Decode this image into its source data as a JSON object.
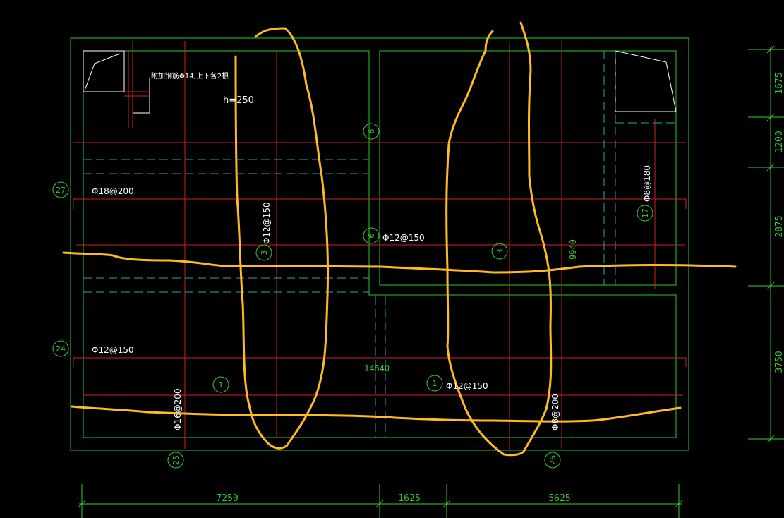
{
  "colors": {
    "background": "#000000",
    "outline": "#22cc22",
    "rebar": "#cc2222",
    "hidden": "#1fa8a8",
    "markup": "#ffbb22",
    "text": "#ffffff",
    "dimension": "#33cc33"
  },
  "annotations": {
    "note": "附加钢筋Φ14,上下各2根",
    "thickness": "h=250",
    "rebar_18_200": "Φ18@200",
    "rebar_12_150_top": "Φ12@150",
    "rebar_12_150_mid": "Φ12@150",
    "rebar_12_150_left": "Φ12@150",
    "rebar_12_150_bottom": "Φ12@150",
    "rebar_16_200": "Φ16@200",
    "rebar_8_200": "Φ8@200",
    "rebar_8_180": "Φ8@180",
    "length_9940": "9940",
    "length_14840": "14840"
  },
  "bubbles": {
    "b27": "27",
    "b24": "24",
    "b25": "25",
    "b26": "26",
    "b6a": "6",
    "b6b": "6",
    "b3a": "3",
    "b3b": "3",
    "b17": "17",
    "b1a": "1",
    "b1b": "1"
  },
  "dimensions": {
    "bottom": [
      "7250",
      "1625",
      "5625"
    ],
    "right": [
      "1675",
      "1200",
      "2875",
      "3750"
    ]
  }
}
